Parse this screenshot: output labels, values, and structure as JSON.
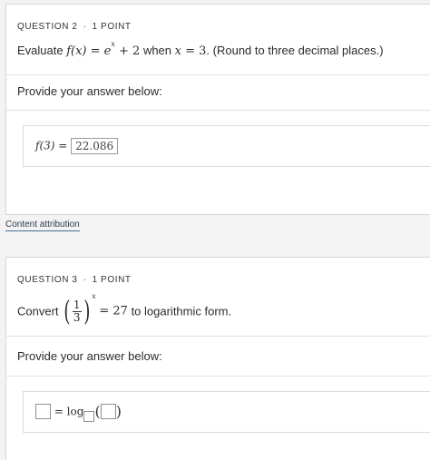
{
  "q2": {
    "label": "QUESTION 2",
    "dot": "·",
    "points": "1 POINT",
    "prompt_pre": "Evaluate ",
    "func": "f(x)",
    "eq": " = ",
    "base": "e",
    "exp": "x",
    "plus": " + 2",
    "when": " when ",
    "xvar": "x",
    "eq2": " = 3",
    "tail": ". (Round to three decimal places.)",
    "provide": "Provide your answer below:",
    "answer_label": "f(3) = ",
    "answer_value": "22.086"
  },
  "attribution": "Content attribution",
  "q3": {
    "label": "QUESTION 3",
    "dot": "·",
    "points": "1 POINT",
    "prompt_pre": "Convert",
    "frac_num": "1",
    "frac_den": "3",
    "lparen": "(",
    "rparen": ")",
    "exp": "x",
    "eq": "= 27",
    "tail": " to logarithmic form.",
    "provide": "Provide your answer below:",
    "ans_eq": " = log",
    "ans_lparen": "(",
    "ans_rparen": ")"
  }
}
